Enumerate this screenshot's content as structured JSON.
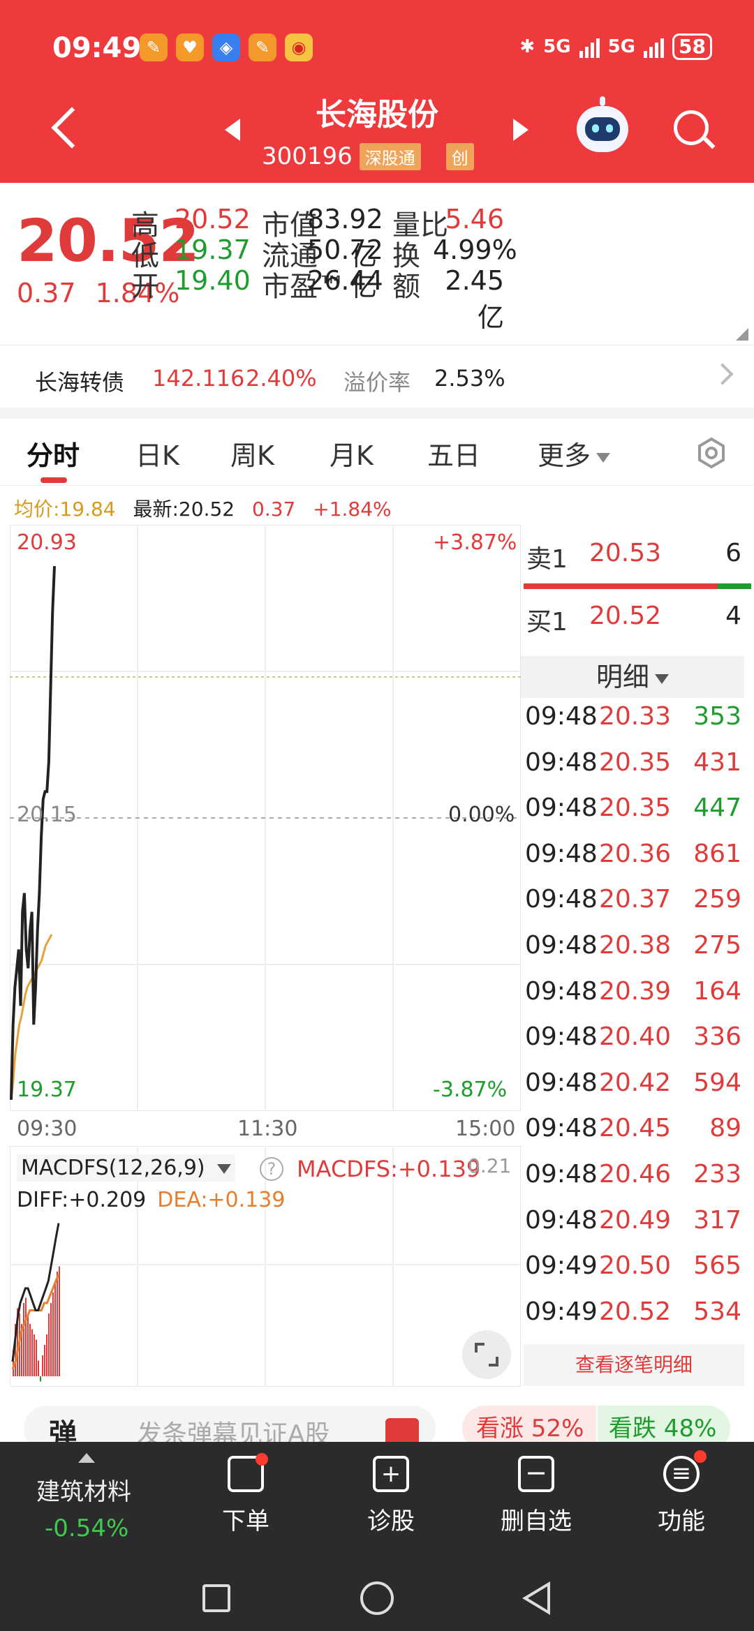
{
  "status": {
    "time": "09:49",
    "signal1": "5G",
    "signal2": "5G",
    "battery": "58"
  },
  "header": {
    "title": "长海股份",
    "code": "300196",
    "tag_connect": "深股通",
    "tag_board": "创"
  },
  "quote": {
    "price": "20.52",
    "change": "0.37",
    "change_pct": "1.84%",
    "high_label": "高",
    "high": "20.52",
    "low_label": "低",
    "low": "19.37",
    "open_label": "开",
    "open": "19.40",
    "mcap_label": "市值",
    "mcap": "83.92亿",
    "float_label": "流通",
    "float": "50.72亿",
    "pe_label": "市盈™",
    "pe": "26.44",
    "vr_label": "量比",
    "vr": "5.46",
    "turn_label": "换",
    "turn": "4.99%",
    "amount_label": "额",
    "amount": "2.45亿"
  },
  "bond": {
    "name": "长海转债",
    "price": "142.116",
    "pct": "2.40%",
    "premium_label": "溢价率",
    "premium": "2.53%"
  },
  "tabs": [
    {
      "label": "分时"
    },
    {
      "label": "日K"
    },
    {
      "label": "周K"
    },
    {
      "label": "月K"
    },
    {
      "label": "五日"
    },
    {
      "label": "更多"
    }
  ],
  "infoline": {
    "avg": "均价:19.84",
    "latest": "最新:20.52",
    "chg": "0.37",
    "pct": "+1.84%"
  },
  "chart_data": {
    "type": "line",
    "y_left_ticks": [
      "20.93",
      "20.15",
      "19.37"
    ],
    "y_right_ticks": [
      "+3.87%",
      "0.00%",
      "-3.87%"
    ],
    "x_ticks": [
      "09:30",
      "11:30",
      "15:00"
    ],
    "ylim": [
      19.37,
      20.93
    ],
    "reference": 20.15,
    "price_series": [
      19.4,
      19.6,
      19.7,
      19.75,
      19.8,
      19.65,
      19.9,
      19.95,
      19.8,
      19.75,
      19.85,
      19.9,
      19.6,
      19.7,
      19.85,
      19.95,
      20.1,
      20.2,
      20.22,
      20.22,
      20.3,
      20.5,
      20.7,
      20.82
    ],
    "avg_series": [
      19.4,
      19.45,
      19.52,
      19.56,
      19.6,
      19.62,
      19.65,
      19.68,
      19.7,
      19.71,
      19.72,
      19.73,
      19.74,
      19.75,
      19.76,
      19.77,
      19.79,
      19.81,
      19.82,
      19.83,
      19.84
    ],
    "price_color": "#222222",
    "avg_color": "#e8a13a",
    "macd": {
      "title": "MACDFS(12,26,9)",
      "value_label": "MACDFS:+0.139",
      "scale": "0.21",
      "diff_label": "DIFF:+0.209",
      "dea_label": "DEA:+0.139",
      "hist": [
        0.05,
        0.1,
        0.13,
        0.12,
        0.1,
        0.14,
        0.15,
        0.12,
        0.1,
        0.09,
        0.08,
        0.07,
        0.03,
        -0.01,
        0.04,
        0.06,
        0.08,
        0.12,
        0.14,
        0.16,
        0.18,
        0.2,
        0.21
      ],
      "diff": [
        0.02,
        0.05,
        0.08,
        0.1,
        0.11,
        0.12,
        0.12,
        0.11,
        0.1,
        0.09,
        0.09,
        0.1,
        0.11,
        0.12,
        0.13,
        0.15,
        0.17,
        0.19,
        0.209
      ],
      "dea": [
        0.01,
        0.02,
        0.04,
        0.06,
        0.07,
        0.08,
        0.09,
        0.09,
        0.09,
        0.09,
        0.09,
        0.1,
        0.1,
        0.11,
        0.12,
        0.13,
        0.139
      ]
    }
  },
  "orderbook": {
    "ask_label": "卖1",
    "ask_price": "20.53",
    "ask_vol": "6",
    "bid_label": "买1",
    "bid_price": "20.52",
    "bid_vol": "4",
    "detail_label": "明细",
    "more_label": "查看逐笔明细",
    "trades": [
      {
        "t": "09:48",
        "p": "20.33",
        "v": "353",
        "c": "green"
      },
      {
        "t": "09:48",
        "p": "20.35",
        "v": "431",
        "c": "red"
      },
      {
        "t": "09:48",
        "p": "20.35",
        "v": "447",
        "c": "green"
      },
      {
        "t": "09:48",
        "p": "20.36",
        "v": "861",
        "c": "red"
      },
      {
        "t": "09:48",
        "p": "20.37",
        "v": "259",
        "c": "red"
      },
      {
        "t": "09:48",
        "p": "20.38",
        "v": "275",
        "c": "red"
      },
      {
        "t": "09:48",
        "p": "20.39",
        "v": "164",
        "c": "red"
      },
      {
        "t": "09:48",
        "p": "20.40",
        "v": "336",
        "c": "red"
      },
      {
        "t": "09:48",
        "p": "20.42",
        "v": "594",
        "c": "red"
      },
      {
        "t": "09:48",
        "p": "20.45",
        "v": "89",
        "c": "red"
      },
      {
        "t": "09:48",
        "p": "20.46",
        "v": "233",
        "c": "red"
      },
      {
        "t": "09:48",
        "p": "20.49",
        "v": "317",
        "c": "red"
      },
      {
        "t": "09:49",
        "p": "20.50",
        "v": "565",
        "c": "red"
      },
      {
        "t": "09:49",
        "p": "20.52",
        "v": "534",
        "c": "red"
      }
    ]
  },
  "danmu": {
    "icon_text": "弹",
    "placeholder": "发条弹幕见证A股",
    "up": "看涨 52%",
    "down": "看跌 48%"
  },
  "bottombar": {
    "sector": "建筑材料",
    "sector_chg": "-0.54%",
    "items": [
      {
        "label": "下单"
      },
      {
        "label": "诊股"
      },
      {
        "label": "删自选"
      },
      {
        "label": "功能"
      }
    ]
  }
}
